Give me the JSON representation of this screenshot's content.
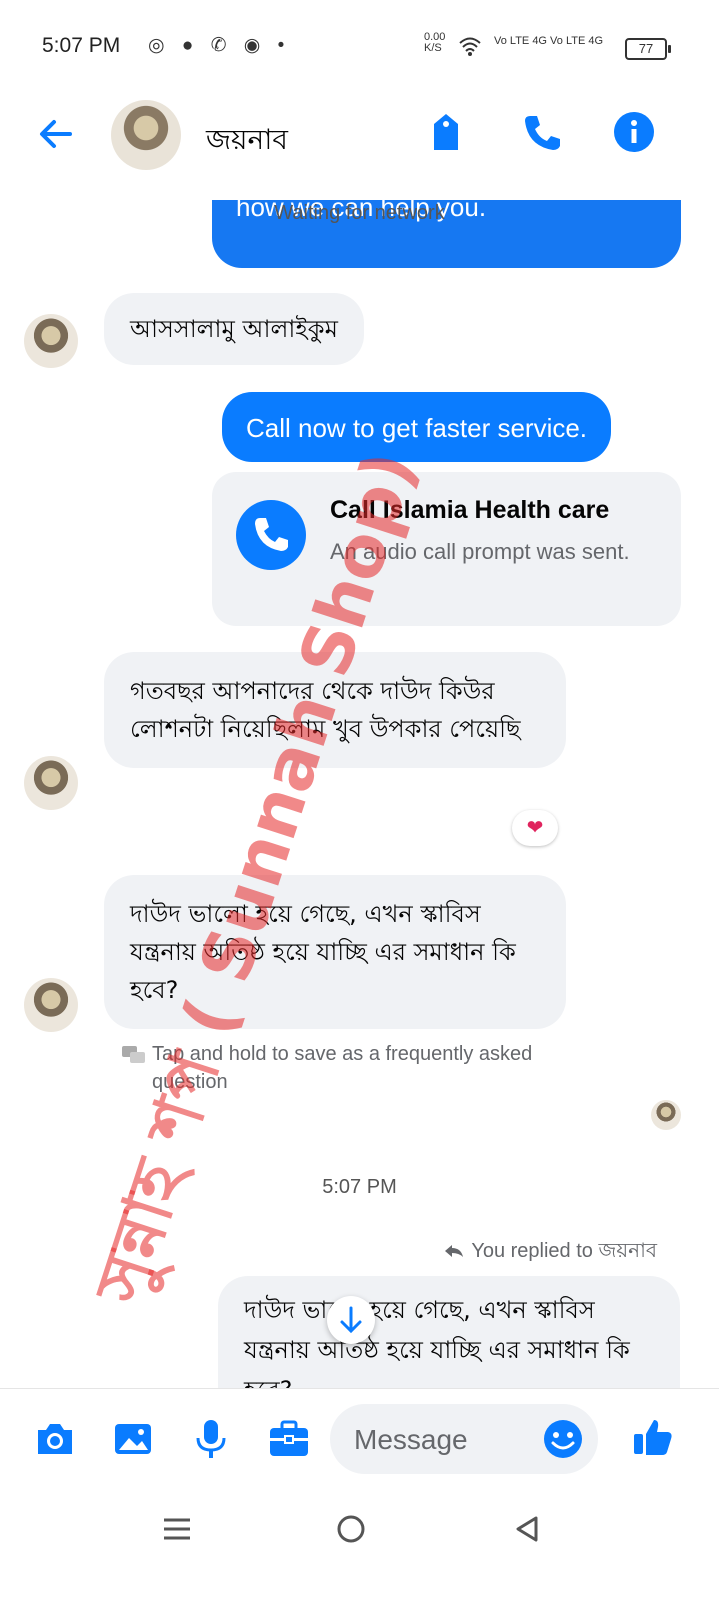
{
  "status_bar": {
    "time": "5:07 PM",
    "net_speed": "0.00 K/S",
    "signal_text": "Vo LTE 4G Vo LTE 4G",
    "battery": "77"
  },
  "header": {
    "contact_name": "জয়নাব",
    "network_status": "Waiting for network"
  },
  "messages": {
    "partial_top_text": "how we can help you.",
    "greeting": "আসসালামু আলাইকুম",
    "outgoing_call_prompt": "Call now to get faster service.",
    "call_card_title": "Call Islamia Health care",
    "call_card_subtitle": "An audio call prompt was sent.",
    "msg_lotion": "গতবছর আপনাদের থেকে দাউদ কিউর লোশনটা নিয়েছিলাম খুব উপকার পেয়েছি",
    "reaction": "❤",
    "msg_scabies": "দাউদ ভালো হয়ে গেছে,  এখন স্কাবিস যন্ত্রনায় অতিষ্ঠ হয়ে যাচ্ছি এর সমাধান কি হবে?",
    "faq_hint": "Tap and hold to save as a frequently asked question",
    "timestamp": "5:07 PM",
    "replied_to": "You replied to জয়নাব",
    "quoted_reply": "দাউদ ভালো হয়ে গেছে,  এখন স্কাবিস যন্ত্রনায় অতিষ্ঠ হয়ে যাচ্ছি এর সমাধান কি হবে?"
  },
  "composer": {
    "placeholder": "Message"
  },
  "watermark": "সুন্নাহ শপ ( Sunnah Shop)",
  "colors": {
    "accent": "#0a7cff",
    "bubble_in": "#f0f2f5",
    "watermark": "#e62828"
  },
  "icons": [
    "back-arrow-icon",
    "tag-icon",
    "phone-icon",
    "info-icon",
    "camera-icon",
    "image-icon",
    "mic-icon",
    "briefcase-icon",
    "emoji-icon",
    "thumbs-up-icon",
    "menu-icon",
    "home-icon",
    "back-triangle-icon",
    "scroll-down-arrow-icon",
    "chat-bubbles-icon",
    "reply-arrow-icon",
    "heart-icon"
  ]
}
